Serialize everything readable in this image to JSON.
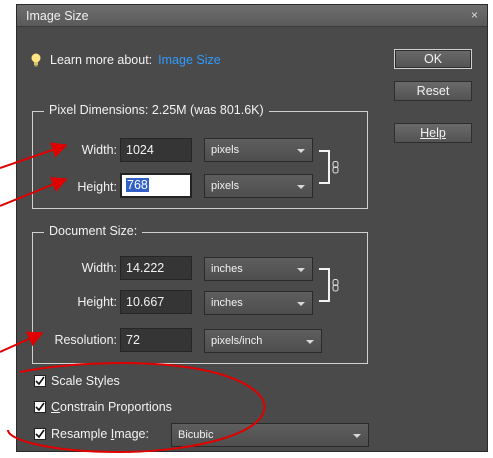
{
  "window": {
    "title": "Image Size",
    "close_glyph": "×"
  },
  "learn": {
    "text": "Learn more about:",
    "link": "Image Size",
    "icon": "lightbulb-icon"
  },
  "buttons": {
    "ok": "OK",
    "reset": "Reset",
    "help": "Help"
  },
  "pixel_dimensions": {
    "legend": "Pixel Dimensions:  2.25M (was 801.6K)",
    "width_label": "Width:",
    "width_value": "1024",
    "width_unit": "pixels",
    "height_label": "Height:",
    "height_value": "768",
    "height_unit": "pixels"
  },
  "document_size": {
    "legend": "Document Size:",
    "width_label": "Width:",
    "width_value": "14.222",
    "width_unit": "inches",
    "height_label": "Height:",
    "height_value": "10.667",
    "height_unit": "inches",
    "resolution_label": "Resolution:",
    "resolution_value": "72",
    "resolution_unit": "pixels/inch"
  },
  "options": {
    "scale_styles": {
      "label": "Scale Styles",
      "checked": true
    },
    "constrain": {
      "label_u": "C",
      "label_rest": "onstrain Proportions",
      "checked": true
    },
    "resample": {
      "label_pre": "Resample ",
      "label_u": "I",
      "label_post": "mage:",
      "checked": true,
      "method": "Bicubic"
    }
  },
  "colors": {
    "dialog_bg": "#4a4a4a",
    "link": "#2f9bff",
    "annotation": "#e00000",
    "selection": "#3060c8"
  }
}
